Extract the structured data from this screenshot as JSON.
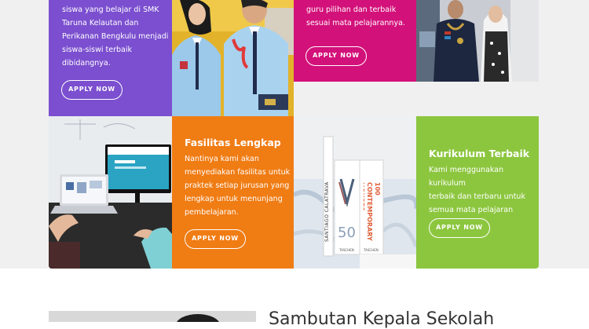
{
  "cards": {
    "intro": {
      "text_lines": [
        "siswa yang belajar di SMK",
        "Taruna Kelautan dan",
        "Perikanan Bengkulu menjadi",
        "siswa-siswi terbaik",
        "dibidangnya."
      ],
      "button": "APPLY NOW"
    },
    "guru": {
      "text_lines": [
        "guru pilihan dan terbaik",
        "sesuai mata pelajarannya."
      ],
      "button": "APPLY NOW"
    },
    "fasilitas": {
      "title": "Fasilitas Lengkap",
      "text_lines": [
        "Nantinya kami akan",
        "menyediakan fasilitas untuk",
        "praktek setiap jurusan yang",
        "lengkap untuk menunjang",
        "pembelajaran."
      ],
      "button": "APPLY NOW"
    },
    "kurikulum": {
      "title": "Kurikulum Terbaik",
      "text_lines": [
        "Kami menggunakan kurikulum",
        "terbaik dan terbaru untuk",
        "semua mata pelajaran"
      ],
      "button": "APPLY NOW"
    }
  },
  "photos": {
    "book_spine_text": "SANTIAGO CALATRAVA",
    "book1_text": "50",
    "book2_text": "100 CONTEMPORARY HOUSES",
    "book_brand": "TASCHEN"
  },
  "welcome": {
    "title": "Sambutan Kepala Sekolah"
  },
  "colors": {
    "purple": "#7b4fcf",
    "magenta": "#d3117a",
    "orange": "#f07c14",
    "green": "#8cc63f",
    "band": "#f0f0f0"
  }
}
